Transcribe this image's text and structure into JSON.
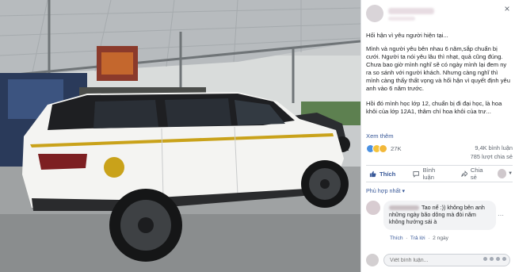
{
  "post": {
    "close_glyph": "×",
    "title": "Hối hận vì yêu người hiện tại...",
    "body": [
      "Mình và người yêu bên nhau 6 năm,sắp chuẩn bị cưới. Người ta nói yêu lâu thì nhạt, quả cũng đúng. Chưa bao giờ mình nghĩ sẽ có ngày mình lại đem ny ra so sánh với người khách. Nhưng càng nghĩ thì mình càng thấy thất vọng và hối hận vì quyết định yêu anh vào 6 năm trước.",
      "Hồi đó mình học lớp 12, chuẩn bị đi đại học, là hoa khôi của lớp 12A1, thâm chí hoa khôi của trư..."
    ],
    "see_more": "Xem thêm"
  },
  "stats": {
    "reactions_count": "27K",
    "comments": "9,4K bình luận",
    "shares": "785 lượt chia sẻ"
  },
  "actions": {
    "like": "Thích",
    "comment": "Bình luận",
    "share": "Chia sẻ"
  },
  "sort_label": "Phù hợp nhất ▾",
  "comment": {
    "text": "Tao nể :)) không bên anh những ngày bão dông mà đòi năm không hưởng sái à",
    "like": "Thích",
    "reply": "Trả lời",
    "time": "2 ngày"
  },
  "write_placeholder": "Viết bình luận...",
  "colors": {
    "accent": "#385898",
    "like_blue": "#4a90e2",
    "car_white": "#f4f4f2",
    "car_roof": "#1e1f22",
    "gold_accent": "#c9a21a"
  },
  "icons": {
    "close": "close-icon",
    "like": "thumbs-up-icon",
    "comment": "comment-bubble-icon",
    "share": "share-arrow-icon"
  }
}
